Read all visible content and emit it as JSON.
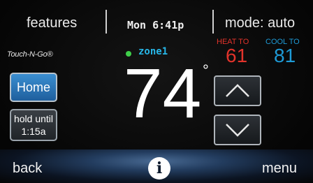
{
  "top_bar": {
    "features_label": "features",
    "datetime": "Mon 6:41p",
    "mode_label": "mode: auto"
  },
  "setpoints": {
    "heat_label": "HEAT TO",
    "heat_value": "61",
    "cool_label": "COOL TO",
    "cool_value": "81",
    "heat_color": "#e2332b",
    "cool_color": "#1e9ad6"
  },
  "brand": {
    "text": "Touch-N-Go®"
  },
  "zone": {
    "label": "zone1",
    "status_color": "#3fcf4a"
  },
  "temperature": {
    "value": "74",
    "unit_symbol": "°"
  },
  "left_buttons": {
    "home_label": "Home",
    "hold_line1": "hold until",
    "hold_line2": "1:15a"
  },
  "arrows": {
    "up_icon": "chevron-up-icon",
    "down_icon": "chevron-down-icon"
  },
  "bottom_bar": {
    "back_label": "back",
    "info_label": "i",
    "menu_label": "menu"
  }
}
